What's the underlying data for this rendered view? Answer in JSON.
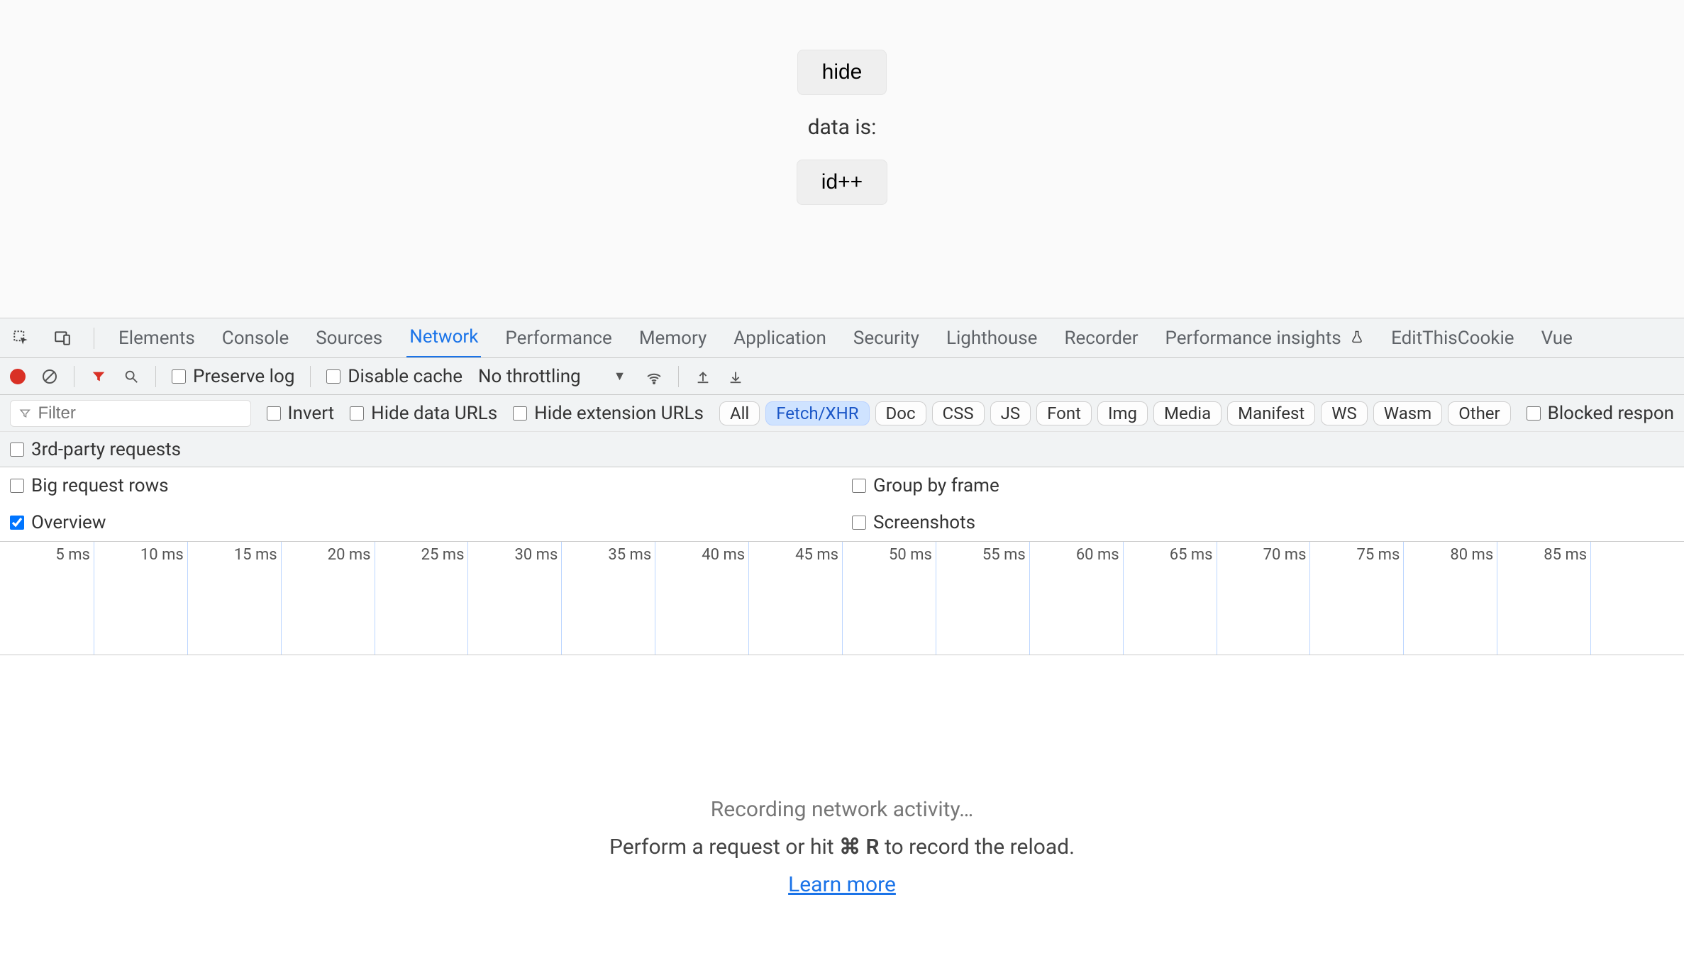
{
  "page": {
    "hide_button": "hide",
    "data_label": "data is:",
    "id_button": "id++"
  },
  "devtools": {
    "tabs": [
      "Elements",
      "Console",
      "Sources",
      "Network",
      "Performance",
      "Memory",
      "Application",
      "Security",
      "Lighthouse",
      "Recorder",
      "Performance insights",
      "EditThisCookie",
      "Vue"
    ],
    "active_tab_index": 3
  },
  "network_toolbar": {
    "preserve_log": "Preserve log",
    "disable_cache": "Disable cache",
    "throttling": "No throttling"
  },
  "filters": {
    "placeholder": "Filter",
    "invert": "Invert",
    "hide_data_urls": "Hide data URLs",
    "hide_ext_urls": "Hide extension URLs",
    "type_pills": [
      "All",
      "Fetch/XHR",
      "Doc",
      "CSS",
      "JS",
      "Font",
      "Img",
      "Media",
      "Manifest",
      "WS",
      "Wasm",
      "Other"
    ],
    "active_pill_index": 1,
    "blocked_respon": "Blocked respon",
    "third_party": "3rd-party requests"
  },
  "options": {
    "big_rows": "Big request rows",
    "group_by_frame": "Group by frame",
    "overview": "Overview",
    "screenshots": "Screenshots",
    "overview_checked": true
  },
  "timeline": {
    "ticks_ms": [
      5,
      10,
      15,
      20,
      25,
      30,
      35,
      40,
      45,
      50,
      55,
      60,
      65,
      70,
      75,
      80,
      85
    ],
    "unit": "ms"
  },
  "empty_state": {
    "title": "Recording network activity…",
    "hint_prefix": "Perform a request or hit ",
    "hint_kbd": "⌘ R",
    "hint_suffix": " to record the reload.",
    "learn_more": "Learn more"
  }
}
